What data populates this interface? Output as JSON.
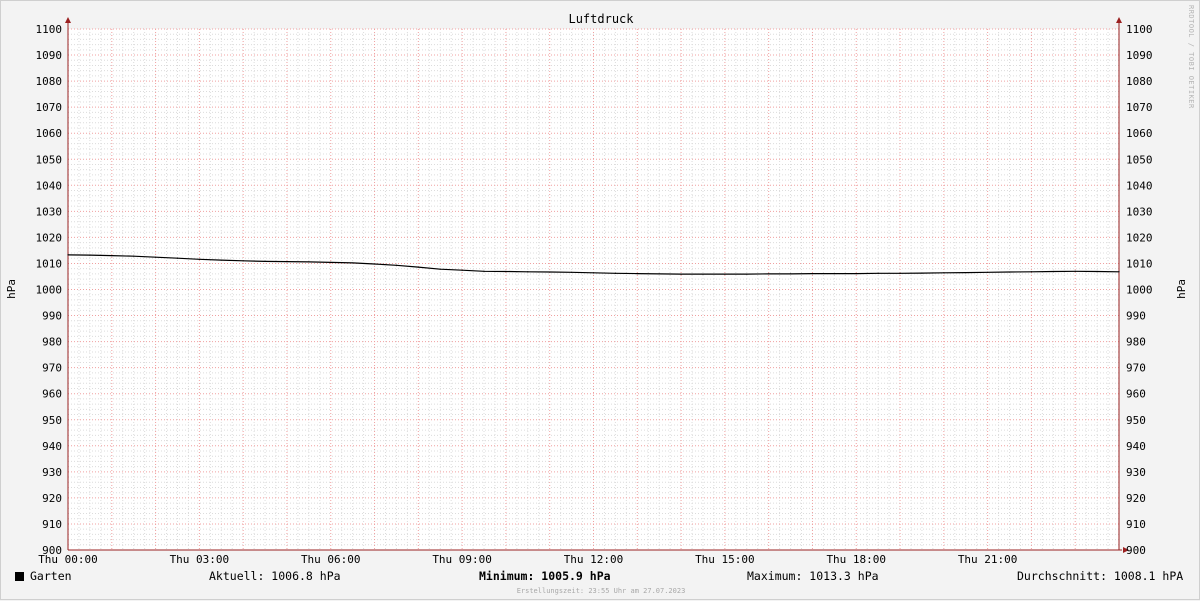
{
  "header": {
    "title": "Luftdruck",
    "side_credit": "RRDTOOL / TOBI OETIKER"
  },
  "colors": {
    "background": "#f3f3f3",
    "plot_area": "#ffffff",
    "grid_minor": "#dcdcdc",
    "grid_major": "#f0a0a0",
    "line": "#000000",
    "axis": "#9a2020"
  },
  "legend": {
    "series_label": "Garten",
    "current": "Aktuell: 1006.8 hPa",
    "minimum": "Minimum: 1005.9 hPa",
    "maximum": "Maximum: 1013.3 hPa",
    "average": "Durchschnitt: 1008.1 hPA"
  },
  "footer": {
    "created": "Erstellungszeit: 23:55 Uhr am 27.07.2023"
  },
  "chart_data": {
    "type": "line",
    "title": "Luftdruck",
    "ylabel": "hPa",
    "ylabel_right": "hPa",
    "xlabel": "",
    "xlim": [
      0,
      24
    ],
    "ylim": [
      900,
      1100
    ],
    "y_ticks": [
      900,
      910,
      920,
      930,
      940,
      950,
      960,
      970,
      980,
      990,
      1000,
      1010,
      1020,
      1030,
      1040,
      1050,
      1060,
      1070,
      1080,
      1090,
      1100
    ],
    "x_ticks": [
      {
        "x": 0,
        "label": "Thu 00:00"
      },
      {
        "x": 3,
        "label": "Thu 03:00"
      },
      {
        "x": 6,
        "label": "Thu 06:00"
      },
      {
        "x": 9,
        "label": "Thu 09:00"
      },
      {
        "x": 12,
        "label": "Thu 12:00"
      },
      {
        "x": 15,
        "label": "Thu 15:00"
      },
      {
        "x": 18,
        "label": "Thu 18:00"
      },
      {
        "x": 21,
        "label": "Thu 21:00"
      }
    ],
    "grid": true,
    "legend_position": "bottom",
    "series": [
      {
        "name": "Garten",
        "x": [
          0,
          0.5,
          1,
          1.5,
          2,
          2.5,
          3,
          3.5,
          4,
          4.5,
          5,
          5.5,
          6,
          6.5,
          7,
          7.5,
          8,
          8.5,
          9,
          9.5,
          10,
          10.5,
          11,
          11.5,
          12,
          12.5,
          13,
          13.5,
          14,
          14.5,
          15,
          15.5,
          16,
          16.5,
          17,
          17.5,
          18,
          18.5,
          19,
          19.5,
          20,
          20.5,
          21,
          21.5,
          22,
          22.5,
          23,
          23.5,
          24
        ],
        "values": [
          1013.3,
          1013.2,
          1013.0,
          1012.8,
          1012.4,
          1012.0,
          1011.6,
          1011.3,
          1011.0,
          1010.8,
          1010.7,
          1010.6,
          1010.4,
          1010.2,
          1009.8,
          1009.3,
          1008.6,
          1007.8,
          1007.4,
          1007.0,
          1006.9,
          1006.8,
          1006.7,
          1006.6,
          1006.4,
          1006.2,
          1006.1,
          1006.0,
          1005.9,
          1005.9,
          1005.9,
          1005.9,
          1006.0,
          1006.0,
          1006.1,
          1006.1,
          1006.1,
          1006.2,
          1006.2,
          1006.3,
          1006.4,
          1006.5,
          1006.6,
          1006.7,
          1006.8,
          1006.9,
          1007.0,
          1006.9,
          1006.8
        ]
      }
    ]
  }
}
